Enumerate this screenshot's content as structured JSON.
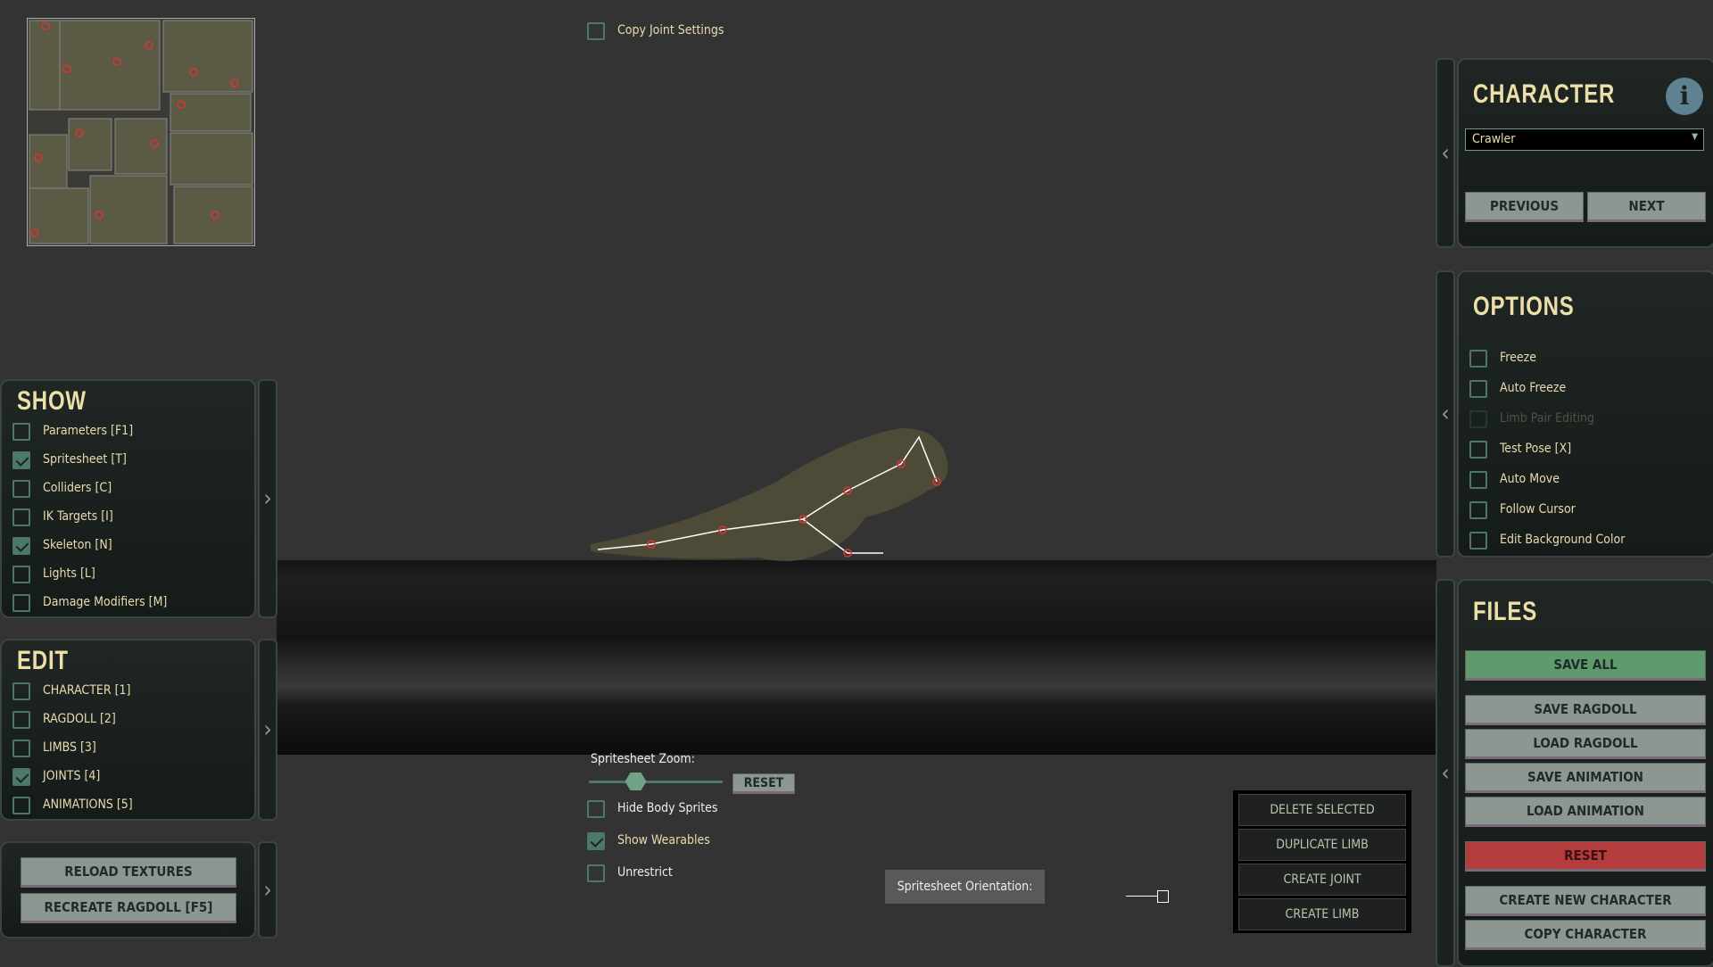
{
  "top": {
    "copy_joint_settings": {
      "label": "Copy Joint Settings",
      "checked": false
    }
  },
  "show": {
    "title": "SHOW",
    "items": [
      {
        "label": "Parameters [F1]",
        "checked": false
      },
      {
        "label": "Spritesheet [T]",
        "checked": true
      },
      {
        "label": "Colliders [C]",
        "checked": false
      },
      {
        "label": "IK Targets [I]",
        "checked": false
      },
      {
        "label": "Skeleton [N]",
        "checked": true
      },
      {
        "label": "Lights [L]",
        "checked": false
      },
      {
        "label": "Damage Modifiers [M]",
        "checked": false
      }
    ]
  },
  "edit": {
    "title": "EDIT",
    "items": [
      {
        "label": "CHARACTER [1]",
        "checked": false
      },
      {
        "label": "RAGDOLL [2]",
        "checked": false
      },
      {
        "label": "LIMBS [3]",
        "checked": false
      },
      {
        "label": "JOINTS [4]",
        "checked": true
      },
      {
        "label": "ANIMATIONS [5]",
        "checked": false
      }
    ]
  },
  "tools": {
    "reload_textures": "RELOAD TEXTURES",
    "recreate_ragdoll": "RECREATE RAGDOLL [F5]"
  },
  "character": {
    "title": "CHARACTER",
    "selected": "Crawler",
    "previous": "PREVIOUS",
    "next": "NEXT"
  },
  "options": {
    "title": "OPTIONS",
    "items": [
      {
        "label": "Freeze",
        "checked": false,
        "disabled": false
      },
      {
        "label": "Auto Freeze",
        "checked": false,
        "disabled": false
      },
      {
        "label": "Limb Pair Editing",
        "checked": false,
        "disabled": true
      },
      {
        "label": "Test Pose [X]",
        "checked": false,
        "disabled": false
      },
      {
        "label": "Auto Move",
        "checked": false,
        "disabled": false
      },
      {
        "label": "Follow Cursor",
        "checked": false,
        "disabled": false
      },
      {
        "label": "Edit Background Color",
        "checked": false,
        "disabled": false
      }
    ]
  },
  "files": {
    "title": "FILES",
    "buttons": [
      "SAVE ALL",
      "SAVE RAGDOLL",
      "LOAD RAGDOLL",
      "SAVE ANIMATION",
      "LOAD ANIMATION",
      "RESET",
      "CREATE NEW CHARACTER",
      "COPY CHARACTER"
    ]
  },
  "spritesheet": {
    "zoom_label": "Spritesheet Zoom:",
    "zoom_value": 0.35,
    "reset": "RESET",
    "orientation_label": "Spritesheet Orientation:",
    "options": [
      {
        "label": "Hide Body Sprites",
        "checked": false
      },
      {
        "label": "Show Wearables",
        "checked": true
      },
      {
        "label": "Unrestrict",
        "checked": false
      }
    ]
  },
  "limb_actions": [
    "DELETE SELECTED",
    "DUPLICATE LIMB",
    "CREATE JOINT",
    "CREATE LIMB"
  ],
  "colors": {
    "accent": "#4d7a68",
    "title": "#ece0a8",
    "save_all": "#5e9a6b",
    "reset": "#b43c3c"
  }
}
